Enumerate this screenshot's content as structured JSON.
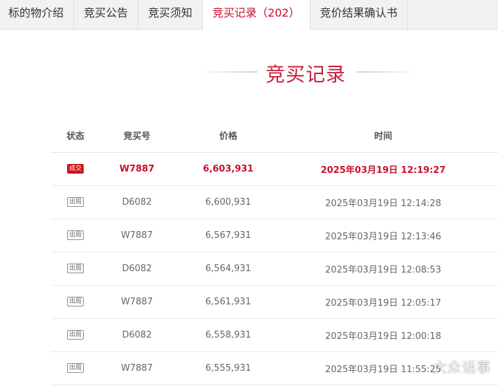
{
  "tabs": [
    {
      "label": "标的物介绍",
      "active": false
    },
    {
      "label": "竞买公告",
      "active": false
    },
    {
      "label": "竞买须知",
      "active": false
    },
    {
      "label": "竞买记录（202）",
      "active": true
    },
    {
      "label": "竞价结果确认书",
      "active": false
    }
  ],
  "section_title": "竞买记录",
  "table": {
    "headers": [
      "状态",
      "竞买号",
      "价格",
      "时间"
    ],
    "rows": [
      {
        "status": "成交",
        "bidder": "W7887",
        "price": "6,603,931",
        "time": "2025年03月19日 12:19:27",
        "highlight": true
      },
      {
        "status": "出局",
        "bidder": "D6082",
        "price": "6,600,931",
        "time": "2025年03月19日 12:14:28",
        "highlight": false
      },
      {
        "status": "出局",
        "bidder": "W7887",
        "price": "6,567,931",
        "time": "2025年03月19日 12:13:46",
        "highlight": false
      },
      {
        "status": "出局",
        "bidder": "D6082",
        "price": "6,564,931",
        "time": "2025年03月19日 12:08:53",
        "highlight": false
      },
      {
        "status": "出局",
        "bidder": "W7887",
        "price": "6,561,931",
        "time": "2025年03月19日 12:05:17",
        "highlight": false
      },
      {
        "status": "出局",
        "bidder": "D6082",
        "price": "6,558,931",
        "time": "2025年03月19日 12:00:18",
        "highlight": false
      },
      {
        "status": "出局",
        "bidder": "W7887",
        "price": "6,555,931",
        "time": "2025年03月19日 11:55:25",
        "highlight": false
      }
    ]
  },
  "watermark": "大众话事",
  "colors": {
    "accent": "#c8102e",
    "deal_badge": "#d0121a",
    "tab_bar": "#f2f2f2"
  }
}
